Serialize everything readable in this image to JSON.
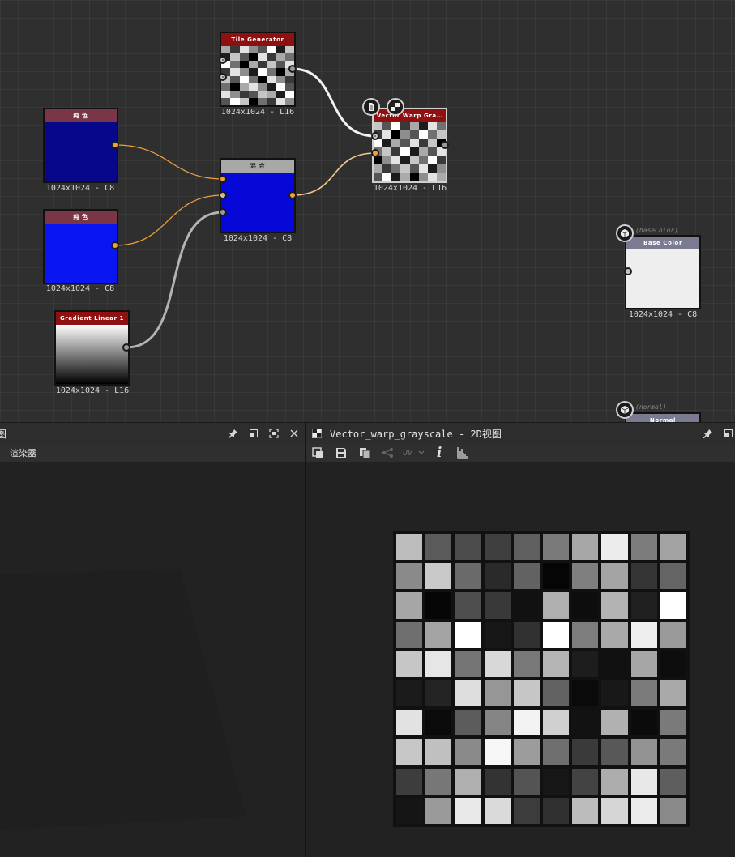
{
  "graph": {
    "nodes": {
      "color1": {
        "title": "纯 色",
        "caption": "1024x1024 - C8",
        "title_bg": "#7a3546",
        "fill": "#06078a"
      },
      "color2": {
        "title": "纯 色",
        "caption": "1024x1024 - C8",
        "title_bg": "#7a3546",
        "fill": "#0a16f2"
      },
      "gradient": {
        "title": "Gradient Linear 1",
        "caption": "1024x1024 - L16",
        "title_bg": "#8e1010"
      },
      "tile": {
        "title": "Tile Generator",
        "caption": "1024x1024 - L16",
        "title_bg": "#8e1010"
      },
      "blend": {
        "title": "混 合",
        "caption": "1024x1024 - C8",
        "title_bg": "#a8a8a8",
        "fill": "#0608d8"
      },
      "warp": {
        "title": "Vector Warp Gra…",
        "caption": "1024x1024 - L16",
        "title_bg": "#8e1010"
      },
      "basecolor": {
        "tag": "(baseColor)",
        "title": "Base Color",
        "caption": "1024x1024 - C8",
        "title_bg": "#7a7a90"
      },
      "normal": {
        "tag": "(normal)",
        "title": "Normal",
        "title_bg": "#7a7a90"
      }
    },
    "tile_pattern": [
      [
        6,
        2,
        8,
        5,
        3,
        9,
        1,
        7
      ],
      [
        1,
        7,
        3,
        0,
        8,
        2,
        6,
        4
      ],
      [
        9,
        4,
        0,
        6,
        2,
        7,
        3,
        8
      ],
      [
        2,
        8,
        5,
        1,
        9,
        4,
        0,
        6
      ],
      [
        7,
        3,
        9,
        4,
        0,
        8,
        5,
        2
      ],
      [
        4,
        0,
        6,
        8,
        5,
        1,
        9,
        3
      ],
      [
        8,
        5,
        2,
        3,
        7,
        6,
        1,
        9
      ],
      [
        3,
        9,
        7,
        0,
        4,
        2,
        8,
        5
      ]
    ],
    "warp_pattern": [
      [
        7,
        3,
        9,
        2,
        6,
        1,
        8,
        4
      ],
      [
        2,
        8,
        0,
        5,
        3,
        9,
        4,
        7
      ],
      [
        9,
        1,
        6,
        3,
        8,
        2,
        7,
        0
      ],
      [
        4,
        7,
        2,
        9,
        1,
        6,
        3,
        8
      ],
      [
        0,
        5,
        8,
        1,
        7,
        4,
        9,
        2
      ],
      [
        6,
        2,
        4,
        7,
        3,
        8,
        1,
        5
      ],
      [
        3,
        9,
        1,
        6,
        0,
        5,
        8,
        6
      ]
    ]
  },
  "panels": {
    "left": {
      "title": "图",
      "tab_label": "渲染器"
    },
    "right": {
      "title": "Vector_warp_grayscale - 2D视图",
      "toolbar_text": "UV"
    }
  },
  "preview": {
    "rows": [
      [
        "#bdbdbd",
        "#5a5a5a",
        "#4b4b4b",
        "#3f3f3f",
        "#5f5f5f",
        "#7a7a7a",
        "#a7a7a7",
        "#ececec",
        "#7c7c7c",
        "#a3a3a3"
      ],
      [
        "#8a8a8a",
        "#c9c9c9",
        "#6a6a6a",
        "#2a2a2a",
        "#626262",
        "#050505",
        "#7f7f7f",
        "#a4a4a4",
        "#353535",
        "#646464"
      ],
      [
        "#a6a6a6",
        "#060606",
        "#4e4e4e",
        "#393939",
        "#111111",
        "#afafaf",
        "#0d0d0d",
        "#b3b3b3",
        "#202020",
        "#ffffff"
      ],
      [
        "#6f6f6f",
        "#a4a4a4",
        "#ffffff",
        "#171717",
        "#313131",
        "#ffffff",
        "#7d7d7d",
        "#a9a9a9",
        "#eeeeee",
        "#9a9a9a"
      ],
      [
        "#c6c6c6",
        "#e6e6e6",
        "#757575",
        "#d8d8d8",
        "#787878",
        "#b5b5b5",
        "#1d1d1d",
        "#111111",
        "#a6a6a6",
        "#0d0d0d"
      ],
      [
        "#1b1b1b",
        "#242424",
        "#dedede",
        "#969696",
        "#c6c6c6",
        "#626262",
        "#0a0a0a",
        "#181818",
        "#7b7b7b",
        "#a9a9a9"
      ],
      [
        "#e2e2e2",
        "#0a0a0a",
        "#5c5c5c",
        "#858585",
        "#f3f3f3",
        "#d0d0d0",
        "#121212",
        "#b1b1b1",
        "#0b0b0b",
        "#7a7a7a"
      ],
      [
        "#c7c7c7",
        "#c0c0c0",
        "#8a8a8a",
        "#f7f7f7",
        "#9c9c9c",
        "#6f6f6f",
        "#3a3a3a",
        "#585858",
        "#939393",
        "#7a7a7a"
      ],
      [
        "#3d3d3d",
        "#777777",
        "#afafaf",
        "#333333",
        "#545454",
        "#171717",
        "#434343",
        "#adadad",
        "#e8e8e8",
        "#5e5e5e"
      ],
      [
        "#151515",
        "#9a9a9a",
        "#e9e9e9",
        "#dadada",
        "#3c3c3c",
        "#303030",
        "#bcbcbc",
        "#d6d6d6",
        "#ebebeb",
        "#8a8a8a"
      ]
    ]
  },
  "colors": {
    "wire_orange": "#f0a23a",
    "wire_white": "#f2f2f2",
    "wire_gray": "#b4b4b4"
  }
}
